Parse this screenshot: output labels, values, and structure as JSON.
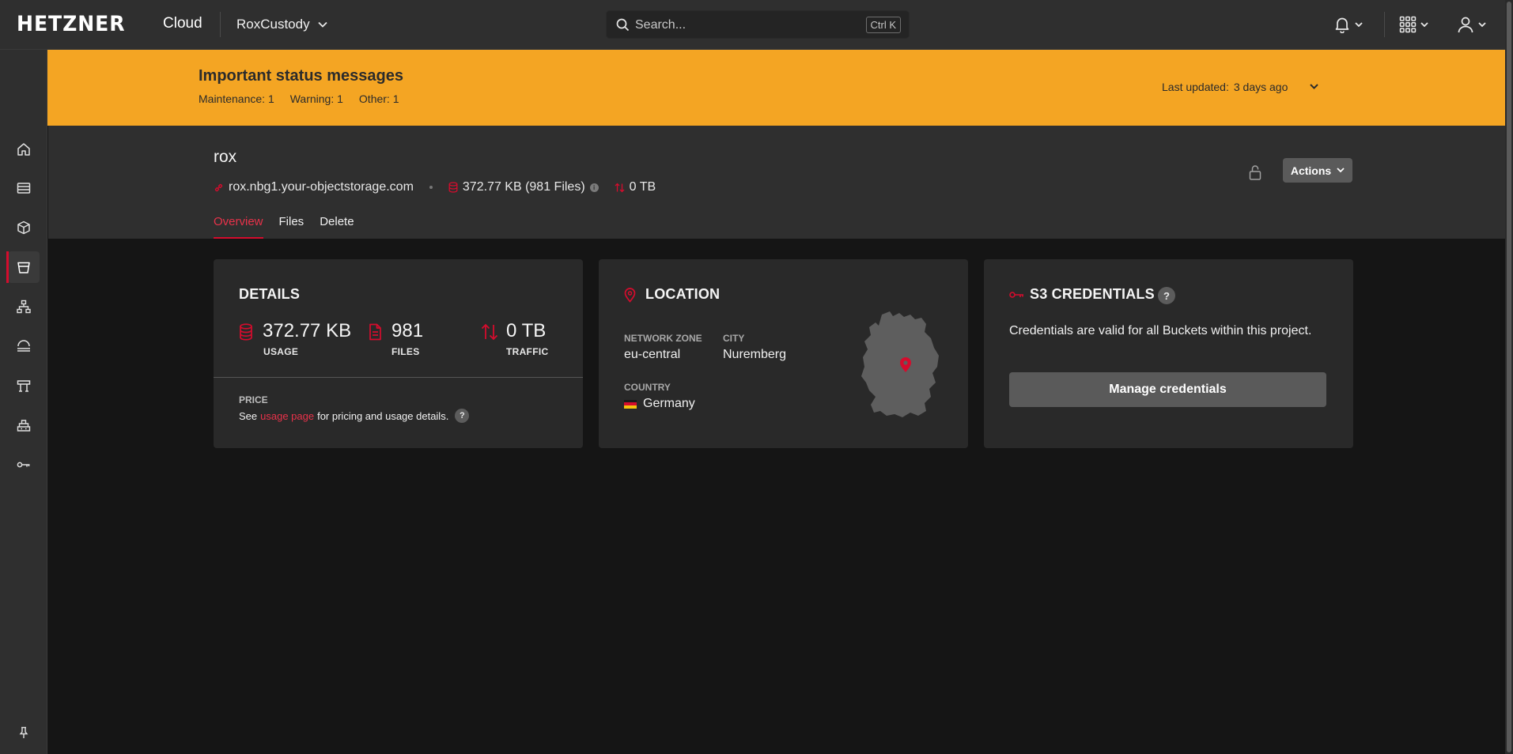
{
  "header": {
    "logo": "HETZNER",
    "logo_sub": "Cloud",
    "project": "RoxCustody",
    "search_placeholder": "Search...",
    "search_shortcut": "Ctrl K",
    "icons": {
      "notifications": "bell-icon",
      "apps": "grid-icon",
      "user": "user-icon"
    }
  },
  "sidebar": {
    "items": [
      {
        "icon": "home-icon",
        "active": false
      },
      {
        "icon": "servers-icon",
        "active": false
      },
      {
        "icon": "volumes-icon",
        "active": false
      },
      {
        "icon": "object-storage-icon",
        "active": true
      },
      {
        "icon": "networks-icon",
        "active": false
      },
      {
        "icon": "load-balancer-icon",
        "active": false
      },
      {
        "icon": "firewall-icon",
        "active": false
      },
      {
        "icon": "images-icon",
        "active": false
      },
      {
        "icon": "security-key-icon",
        "active": false
      }
    ],
    "pin_icon": "pin-icon"
  },
  "banner": {
    "title": "Important status messages",
    "maintenance": "Maintenance: 1",
    "warning": "Warning: 1",
    "other": "Other: 1",
    "last_updated_label": "Last updated:",
    "last_updated_value": "3 days ago",
    "color": "#f4a523"
  },
  "bucket": {
    "name": "rox",
    "endpoint": "rox.nbg1.your-objectstorage.com",
    "usage_summary": "372.77 KB (981 Files)",
    "traffic_summary": "0 TB",
    "actions_label": "Actions",
    "tabs": [
      "Overview",
      "Files",
      "Delete"
    ],
    "active_tab": "Overview"
  },
  "details": {
    "title": "DETAILS",
    "usage_value": "372.77 KB",
    "usage_label": "USAGE",
    "files_value": "981",
    "files_label": "FILES",
    "traffic_value": "0 TB",
    "traffic_label": "TRAFFIC",
    "price_label": "PRICE",
    "price_text_before": "See",
    "price_link": "usage page",
    "price_text_after": "for pricing and usage details."
  },
  "location": {
    "title": "LOCATION",
    "network_zone_label": "NETWORK ZONE",
    "network_zone": "eu-central",
    "city_label": "CITY",
    "city": "Nuremberg",
    "country_label": "COUNTRY",
    "country": "Germany"
  },
  "credentials": {
    "title": "S3 CREDENTIALS",
    "description": "Credentials are valid for all Buckets within this project.",
    "button": "Manage credentials"
  },
  "colors": {
    "accent": "#d50c2d",
    "banner": "#f4a523",
    "card": "#292929",
    "page": "#151515",
    "chrome": "#2f2f2f"
  }
}
